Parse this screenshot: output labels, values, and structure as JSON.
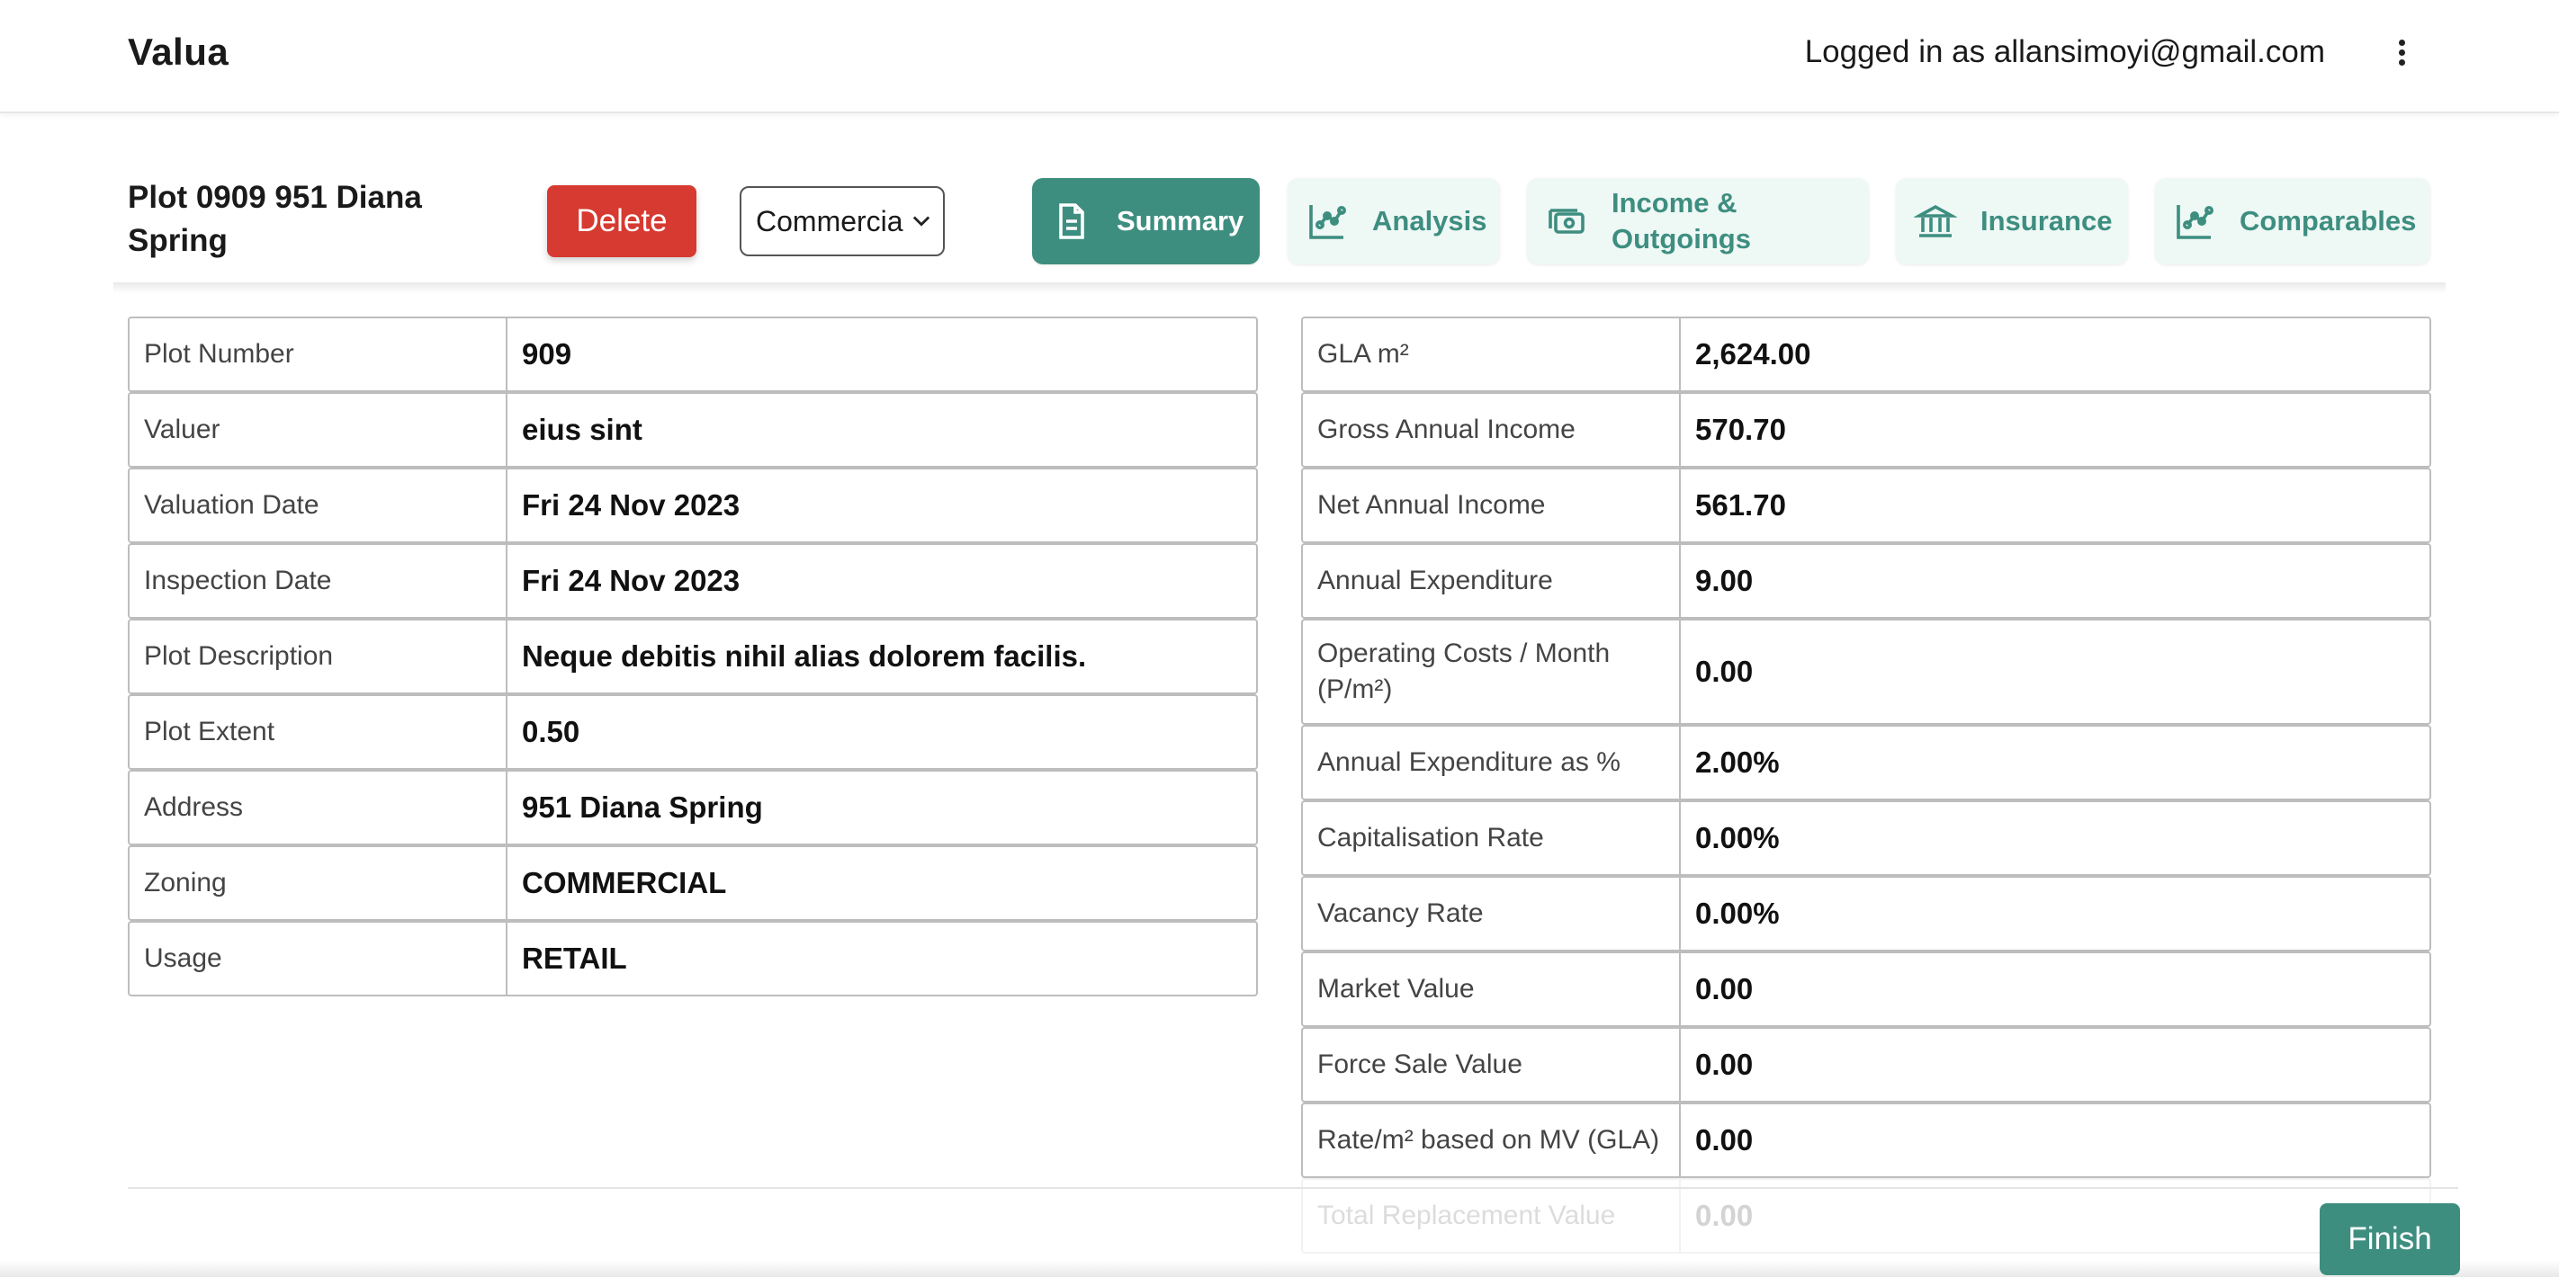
{
  "header": {
    "brand": "Valua",
    "login_text": "Logged in as allansimoyi@gmail.com",
    "menu_icon": "kebab-menu-icon"
  },
  "toolbar": {
    "plot_title": "Plot 0909 951 Diana Spring",
    "delete_label": "Delete",
    "category_select": "Commercia",
    "tabs": [
      {
        "label": "Summary",
        "icon": "document-icon",
        "active": true
      },
      {
        "label": "Analysis",
        "icon": "chart-icon",
        "active": false
      },
      {
        "label": "Income & Outgoings",
        "icon": "cash-icon",
        "active": false
      },
      {
        "label": "Insurance",
        "icon": "bank-icon",
        "active": false
      },
      {
        "label": "Comparables",
        "icon": "chart-icon",
        "active": false
      }
    ],
    "accent_color": "#3e8e80",
    "danger_color": "#d63a31"
  },
  "left_table": [
    {
      "label": "Plot Number",
      "value": "909"
    },
    {
      "label": "Valuer",
      "value": "eius sint"
    },
    {
      "label": "Valuation Date",
      "value": "Fri 24 Nov 2023"
    },
    {
      "label": "Inspection Date",
      "value": "Fri 24 Nov 2023"
    },
    {
      "label": "Plot Description",
      "value": "Neque debitis nihil alias dolorem facilis."
    },
    {
      "label": "Plot Extent",
      "value": "0.50"
    },
    {
      "label": "Address",
      "value": "951 Diana Spring"
    },
    {
      "label": "Zoning",
      "value": "COMMERCIAL"
    },
    {
      "label": "Usage",
      "value": "RETAIL"
    }
  ],
  "right_table": [
    {
      "label": "GLA m²",
      "value": "2,624.00"
    },
    {
      "label": "Gross Annual Income",
      "value": "570.70"
    },
    {
      "label": "Net Annual Income",
      "value": "561.70"
    },
    {
      "label": "Annual Expenditure",
      "value": "9.00"
    },
    {
      "label": "Operating Costs / Month (P/m²)",
      "value": "0.00"
    },
    {
      "label": "Annual Expenditure as %",
      "value": "2.00%"
    },
    {
      "label": "Capitalisation Rate",
      "value": "0.00%"
    },
    {
      "label": "Vacancy Rate",
      "value": "0.00%"
    },
    {
      "label": "Market Value",
      "value": "0.00"
    },
    {
      "label": "Force Sale Value",
      "value": "0.00"
    },
    {
      "label": "Rate/m² based on MV (GLA)",
      "value": "0.00"
    },
    {
      "label": "Total Replacement Value",
      "value": "0.00"
    }
  ],
  "footer": {
    "finish_label": "Finish"
  }
}
